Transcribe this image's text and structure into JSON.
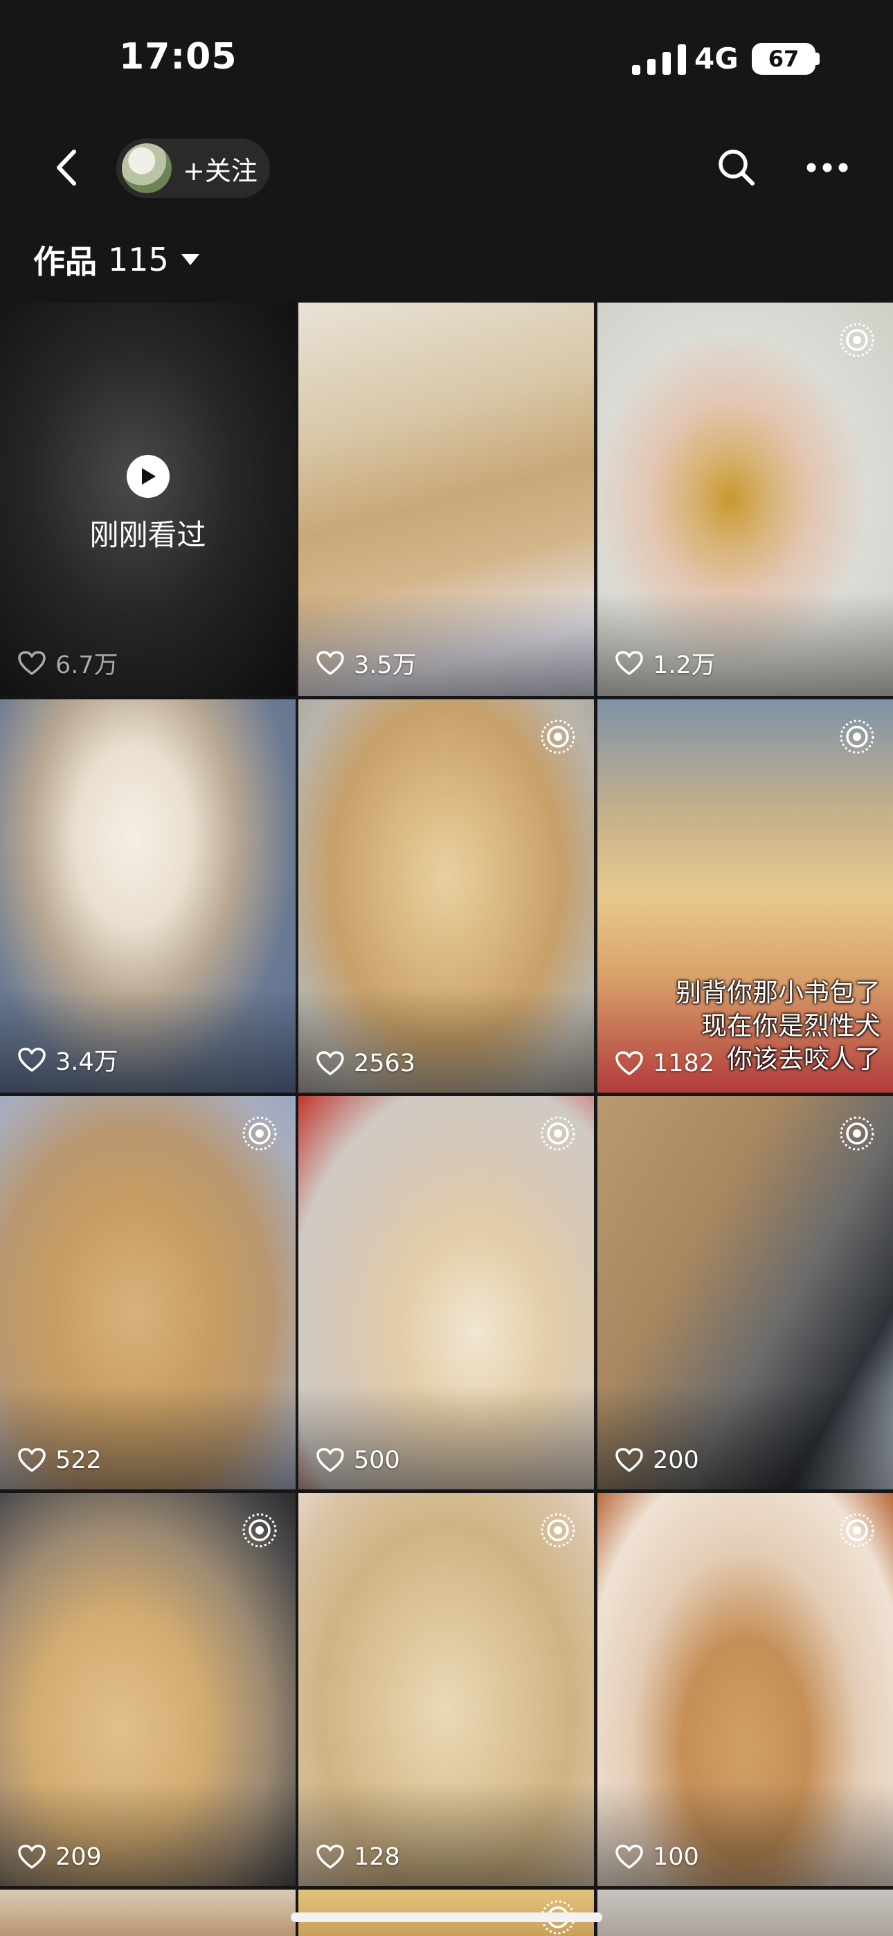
{
  "status_bar": {
    "time": "17:05",
    "network": "4G",
    "battery": "67"
  },
  "nav": {
    "follow_label": "+关注"
  },
  "works": {
    "label": "作品",
    "count": "115"
  },
  "grid": {
    "tiles": [
      {
        "likes": "6.7万",
        "watched_label": "刚刚看过"
      },
      {
        "likes": "3.5万"
      },
      {
        "likes": "1.2万"
      },
      {
        "likes": "3.4万"
      },
      {
        "likes": "2563"
      },
      {
        "likes": "1182",
        "caption_lines": [
          "别背你那小书包了",
          "现在你是烈性犬",
          "你该去咬人了"
        ]
      },
      {
        "likes": "522"
      },
      {
        "likes": "500"
      },
      {
        "likes": "200"
      },
      {
        "likes": "209"
      },
      {
        "likes": "128"
      },
      {
        "likes": "100"
      }
    ]
  },
  "colors": {
    "background": "#161616",
    "text": "#ffffff",
    "pill": "#2a2a2a"
  },
  "icons": [
    "back-arrow-icon",
    "search-icon",
    "more-icon",
    "heart-icon",
    "live-photo-icon",
    "play-icon",
    "signal-icon",
    "battery-icon"
  ]
}
